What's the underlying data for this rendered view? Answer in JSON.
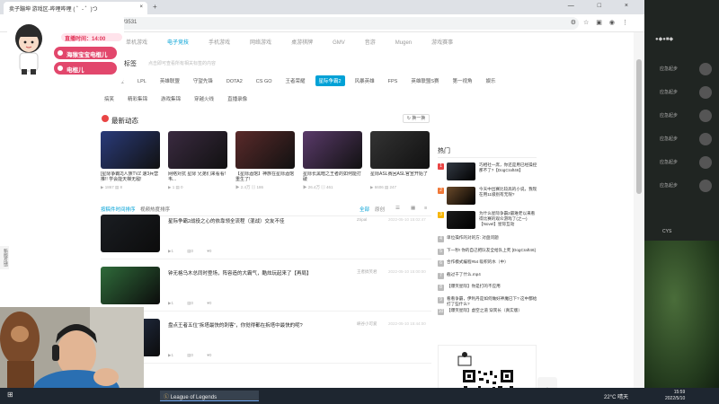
{
  "browser": {
    "tab_title": "卖子蹦坤 游戏区-哔哩哔哩 ( ゜- ゜)つ",
    "tab_close": "×",
    "new_tab": "+",
    "url": "bilibili.com/v/game/esports/#/3531",
    "window_controls": "—  □  ×"
  },
  "overlay": {
    "badge": "直播时间：14:00",
    "pill1": "海猴宝宝电棍儿",
    "pill2": "电棍儿"
  },
  "categories": [
    "单机游戏",
    "电子竞技",
    "手机游戏",
    "网络游戏",
    "桌游棋牌",
    "GMV",
    "音游",
    "Mugen",
    "游戏赛事"
  ],
  "active_category_index": 1,
  "hot_tags": {
    "title": "热门标签",
    "subtitle": "点击即可查看所有相关标签的内容",
    "items": [
      "全部标签",
      "LPL",
      "英雄联盟",
      "守望先锋",
      "DOTA2",
      "CS GO",
      "王者荣耀",
      "星际争霸2",
      "风暴英雄",
      "FPS",
      "英雄联盟S赛",
      "第一视角",
      "娱乐",
      "搞笑",
      "精彩集锦",
      "游戏集锦",
      "穿越火线",
      "直播录像"
    ],
    "active_index": 7
  },
  "latest": {
    "title": "最新动态",
    "refresh": "换一换",
    "cards": [
      {
        "title": "[星际争霸2]人族TVZ 速3兵营推!! 学会能天梯无敌!",
        "plays": "1867",
        "comments": "8"
      },
      {
        "title": "网络对抗 星际 兄弟们来看看! 韦...",
        "plays": "1",
        "comments": "0"
      },
      {
        "title": "【星际酒馆】神族在星际酒馆重生了!",
        "plays": "2.4万",
        "comments": "186"
      },
      {
        "title": "星际长黑暗之王者的如何能打破",
        "plays": "26.4万",
        "comments": "461"
      },
      {
        "title": "星际ASL赛回ASL官宣开始了",
        "plays": "6606",
        "comments": "247"
      }
    ]
  },
  "list_tabs": {
    "tab1": "按稿件时间排序",
    "tab2": "视频热度排序",
    "all": "全部",
    "original": "原创"
  },
  "videos": [
    {
      "title": "星际争霸2战役之心的依靠领全流程（混战）交友不佳",
      "uploader": "Zripal",
      "date": "2022-05-10 15:02:47",
      "plays": "1",
      "comments": "0",
      "likes": "0"
    },
    {
      "title": "钟无格乌木总同时登场，阵容造的大霸气，酷炫玩起来了【再局】",
      "uploader": "王者搞笑君",
      "date": "2022-05-10 15:00:00",
      "plays": "1",
      "comments": "0",
      "likes": "0"
    },
    {
      "title": "盘点王者五位“拆塔最快的刺客”，你觉得都在拆塔中最快的呢?",
      "uploader": "峡谷小可爱",
      "date": "2022-05-10 15:44:00",
      "plays": "1",
      "comments": "0",
      "likes": "0"
    }
  ],
  "hot": {
    "title": "热门",
    "items": [
      {
        "num": "1",
        "title": "巧相社一席，你还是用已经操控那不了?【DogCraft46】",
        "thumb": true
      },
      {
        "num": "2",
        "title": "今天中出赛比较高的小说，我现在用11级别有无限?",
        "thumb": true
      },
      {
        "num": "3",
        "title": "为什么星际争霸2最难老以来看得比赛的观众游戏了(之一)【Novel】星际互动",
        "thumb": true
      },
      {
        "num": "4",
        "title": "单位操作的对的方: 对盘问题",
        "thumb": false
      },
      {
        "num": "5",
        "title": "下一秒! 你的自己把队友全给队上死 [DogCraft46]",
        "thumb": false
      },
      {
        "num": "6",
        "title": "合作模式编程#54 吸积的水（中）",
        "thumb": false
      },
      {
        "num": "7",
        "title": "截过干了什么.mp4",
        "thumb": false
      },
      {
        "num": "8",
        "title": "【爆笑星际】你是打的不应用",
        "thumb": false
      },
      {
        "num": "9",
        "title": "看看争霸，伊利丹是如何做好神魔已下? 这中都给打了些什么?",
        "thumb": false
      },
      {
        "num": "10",
        "title": "【爆笑星际】虚空之道 穿宾长（真实版）",
        "thumb": false
      }
    ]
  },
  "feedback": "新版反馈",
  "back_to_top": "︿",
  "taskbar": {
    "app": "League of Legends",
    "weather": "22°C 晴天",
    "time": "15:59",
    "date": "2022/5/10"
  },
  "side_panel": {
    "row_label": "应急起步",
    "stats": "CYS"
  },
  "colors": {
    "accent": "#00a1d6",
    "pink": "#e2476c",
    "hot_red": "#e94545"
  }
}
